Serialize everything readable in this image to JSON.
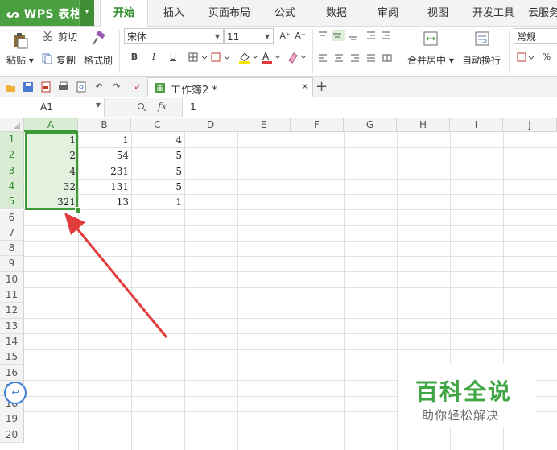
{
  "app": {
    "name": "WPS 表格",
    "logo_glyph": "ᔕ",
    "menu_caret": "▾",
    "accent": "#4aa040"
  },
  "menu_tabs": [
    "开始",
    "插入",
    "页面布局",
    "公式",
    "数据",
    "审阅",
    "视图",
    "开发工具",
    "云服务"
  ],
  "active_tab": "开始",
  "ribbon": {
    "paste": "粘贴",
    "cut": "剪切",
    "copy": "复制",
    "format_painter": "格式刷",
    "font_name": "宋体",
    "font_size": "11",
    "bold": "B",
    "italic": "I",
    "underline": "U",
    "grow_font": "A⁺",
    "shrink_font": "A⁻",
    "merge_center": "合并居中",
    "wrap_text": "自动换行",
    "number_format": "常规",
    "percent": "%"
  },
  "doc_tab": {
    "name": "工作簿2 *",
    "close": "×",
    "new": "+"
  },
  "formula_bar": {
    "cell_ref": "A1",
    "fx": "fx",
    "value": "1"
  },
  "grid": {
    "columns": [
      "A",
      "B",
      "C",
      "D",
      "E",
      "F",
      "G",
      "H",
      "I",
      "J"
    ],
    "rows": [
      "1",
      "2",
      "3",
      "4",
      "5",
      "6",
      "7",
      "8",
      "9",
      "10",
      "11",
      "12",
      "13",
      "14",
      "15",
      "16",
      "17",
      "18",
      "19",
      "20"
    ],
    "cells": {
      "A": [
        "1",
        "2",
        "4",
        "32",
        "321"
      ],
      "B": [
        "1",
        "54",
        "231",
        "131",
        "13"
      ],
      "C": [
        "4",
        "5",
        "5",
        "5",
        "1"
      ]
    },
    "selection": "A1:A5",
    "selection_color": "#3d9a36"
  },
  "annotation": {
    "arrow_color": "#e23b3b"
  },
  "watermark": {
    "title": "百科全说",
    "subtitle": "助你轻松解决"
  }
}
